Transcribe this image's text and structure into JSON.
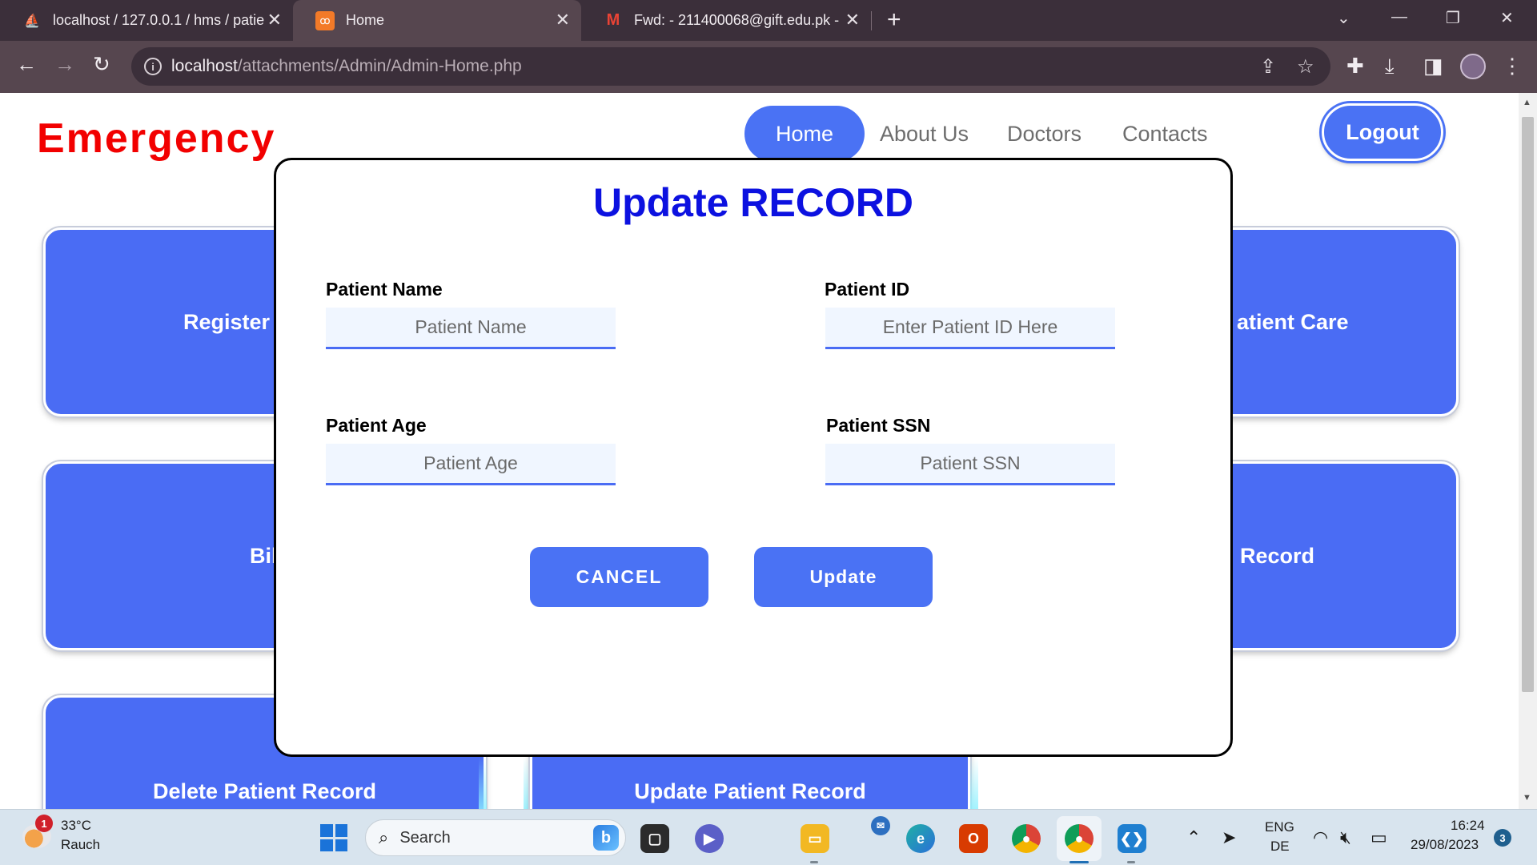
{
  "browser": {
    "tabs": [
      {
        "title": "localhost / 127.0.0.1 / hms / patie",
        "icon": "phpmyadmin-icon",
        "active": false
      },
      {
        "title": "Home",
        "icon": "xampp-icon",
        "active": true
      },
      {
        "title": "Fwd: - 211400068@gift.edu.pk - ",
        "icon": "gmail-icon",
        "active": false
      }
    ],
    "new_tab": "+",
    "url_host": "localhost",
    "url_path": "/attachments/Admin/Admin-Home.php"
  },
  "page": {
    "brand": "Emergency",
    "nav": {
      "home": "Home",
      "about": "About Us",
      "doctors": "Doctors",
      "contacts": "Contacts"
    },
    "logout": "Logout",
    "cards": {
      "register": "Register",
      "patient_care": "atient Care",
      "bill": "Bil",
      "record": "Record",
      "delete": "Delete Patient Record",
      "update": "Update Patient Record"
    }
  },
  "modal": {
    "title": "Update RECORD",
    "fields": {
      "name": {
        "label": "Patient Name",
        "placeholder": "Patient Name"
      },
      "id": {
        "label": "Patient ID",
        "placeholder": "Enter Patient ID Here"
      },
      "age": {
        "label": "Patient Age",
        "placeholder": "Patient Age"
      },
      "ssn": {
        "label": "Patient SSN",
        "placeholder": "Patient SSN"
      }
    },
    "cancel": "CANCEL",
    "update": "Update"
  },
  "taskbar": {
    "weather_temp": "33°C",
    "weather_desc": "Rauch",
    "weather_badge": "1",
    "search": "Search",
    "lang_top": "ENG",
    "lang_bottom": "DE",
    "time": "16:24",
    "date": "29/08/2023",
    "notif_count": "3"
  },
  "colors": {
    "accent": "#4a72f4",
    "brand_red": "#f20000",
    "title_blue": "#0c11e0"
  }
}
